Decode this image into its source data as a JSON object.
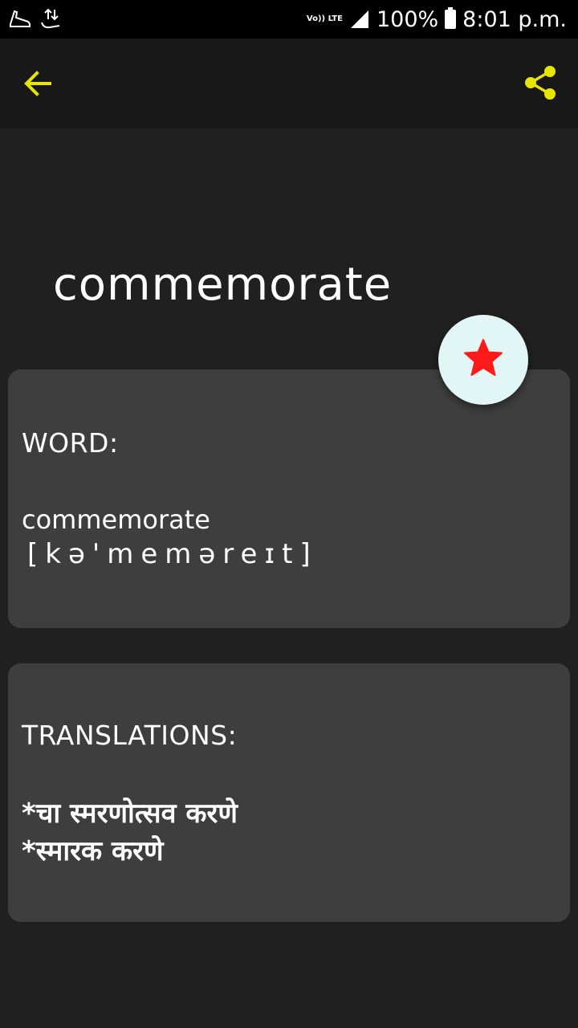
{
  "status_bar": {
    "network_label": "Vo)) LTE",
    "battery": "100%",
    "time": "8:01 p.m."
  },
  "colors": {
    "accent": "#e6e600",
    "background": "#202020",
    "appbar": "#181818",
    "card": "#3e3e3e",
    "fab": "#e3f6f7",
    "star": "#ff1a1a"
  },
  "icons": {
    "back": "arrow-left-icon",
    "share": "share-icon",
    "favorite": "star-icon"
  },
  "word": {
    "title": "commemorate"
  },
  "word_card": {
    "heading": "WORD:",
    "word": "commemorate",
    "phonetic": "[kə'meməreɪt]"
  },
  "translations_card": {
    "heading": "TRANSLATIONS:",
    "items": [
      "*चा स्मरणोत्सव करणे",
      "*स्मारक करणे"
    ]
  }
}
